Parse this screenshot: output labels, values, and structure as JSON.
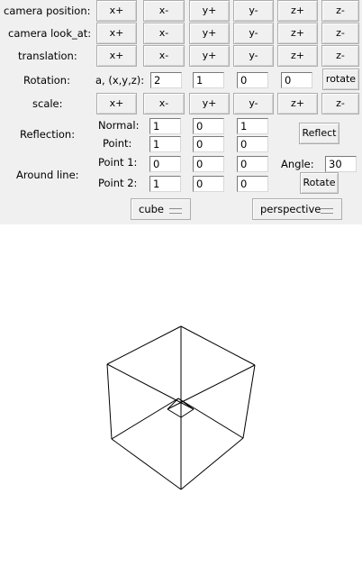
{
  "rows": {
    "camera_position": {
      "label": "camera position:",
      "buttons": [
        "x+",
        "x-",
        "y+",
        "y-",
        "z+",
        "z-"
      ]
    },
    "camera_look_at": {
      "label": "camera look_at:",
      "buttons": [
        "x+",
        "x-",
        "y+",
        "y-",
        "z+",
        "z-"
      ]
    },
    "translation": {
      "label": "translation:",
      "buttons": [
        "x+",
        "x-",
        "y+",
        "y-",
        "z+",
        "z-"
      ]
    },
    "rotation": {
      "label": "Rotation:",
      "sub_label": "a, (x,y,z):",
      "values": [
        "2",
        "1",
        "0",
        "0"
      ],
      "button": "rotate"
    },
    "scale": {
      "label": "scale:",
      "buttons": [
        "x+",
        "x-",
        "y+",
        "y-",
        "z+",
        "z-"
      ]
    }
  },
  "reflection": {
    "label": "Reflection:",
    "normal_label": "Normal:",
    "normal": [
      "1",
      "0",
      "1"
    ],
    "point_label": "Point:",
    "point": [
      "1",
      "0",
      "0"
    ],
    "button": "Reflect"
  },
  "around_line": {
    "label": "Around line:",
    "p1_label": "Point 1:",
    "p1": [
      "0",
      "0",
      "0"
    ],
    "p2_label": "Point 2:",
    "p2": [
      "1",
      "0",
      "0"
    ],
    "angle_label": "Angle:",
    "angle": "30",
    "button": "Rotate"
  },
  "shape_select": {
    "value": "cube"
  },
  "projection_select": {
    "value": "perspective"
  },
  "colors": {
    "panel_bg": "#f0f0f0",
    "canvas_bg": "#ffffff",
    "stroke": "#000000"
  },
  "icons": [
    "dropdown-indicator-icon"
  ]
}
